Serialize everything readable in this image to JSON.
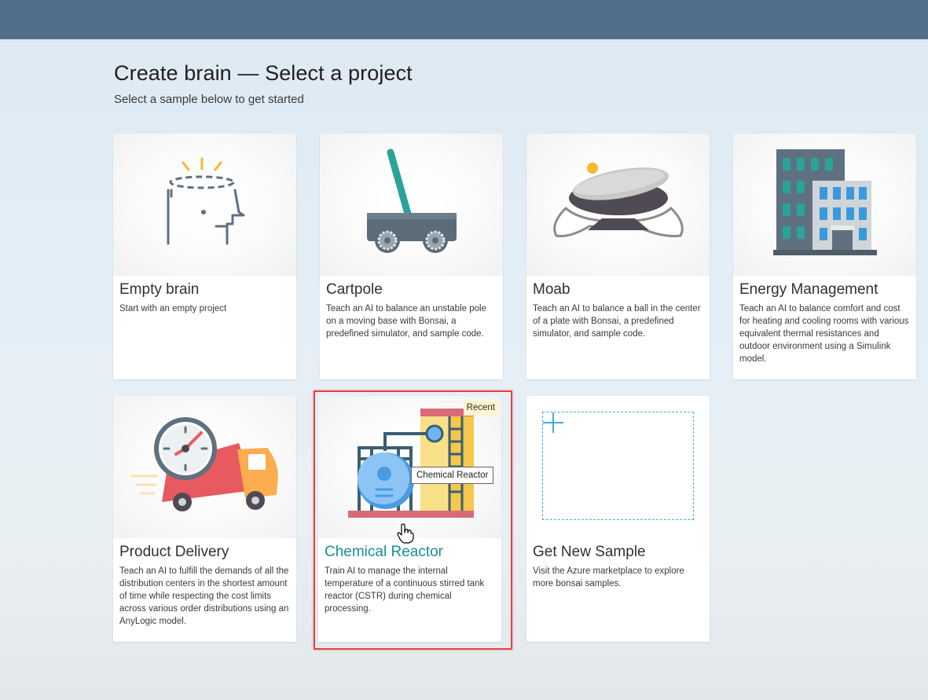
{
  "header": {
    "title": "Create brain — Select a project",
    "subtitle": "Select a sample below to get started"
  },
  "cards": [
    {
      "title": "Empty brain",
      "description": "Start with an empty project",
      "icon": "head-icon"
    },
    {
      "title": "Cartpole",
      "description": "Teach an AI to balance an unstable pole on a moving base with Bonsai, a predefined simulator, and sample code.",
      "icon": "cartpole-icon"
    },
    {
      "title": "Moab",
      "description": "Teach an AI to balance a ball in the center of a plate with Bonsai, a predefined simulator, and sample code.",
      "icon": "moab-icon"
    },
    {
      "title": "Energy Management",
      "description": "Teach an AI to balance comfort and cost for heating and cooling rooms with various equivalent thermal resistances and outdoor environment using a Simulink model.",
      "icon": "building-icon"
    },
    {
      "title": "Product Delivery",
      "description": "Teach an AI to fulfill the demands of all the distribution centers in the shortest amount of time while respecting the cost limits across various order distributions using an AnyLogic model.",
      "icon": "delivery-truck-icon"
    },
    {
      "title": "Chemical Reactor",
      "description": "Train AI to manage the internal temperature of a continuous stirred tank reactor (CSTR) during chemical processing.",
      "icon": "chemical-reactor-icon",
      "badge": "Recent",
      "tooltip": "Chemical Reactor"
    },
    {
      "title": "Get New Sample",
      "description": "Visit the Azure marketplace to explore more bonsai samples.",
      "icon": "plus-icon"
    }
  ],
  "colors": {
    "topbar": "#516f8a",
    "accent": "#1a8f8c",
    "highlight_border": "#e0453f",
    "badge_bg": "#fff4ce",
    "dashed_border": "#4aa8e0"
  }
}
